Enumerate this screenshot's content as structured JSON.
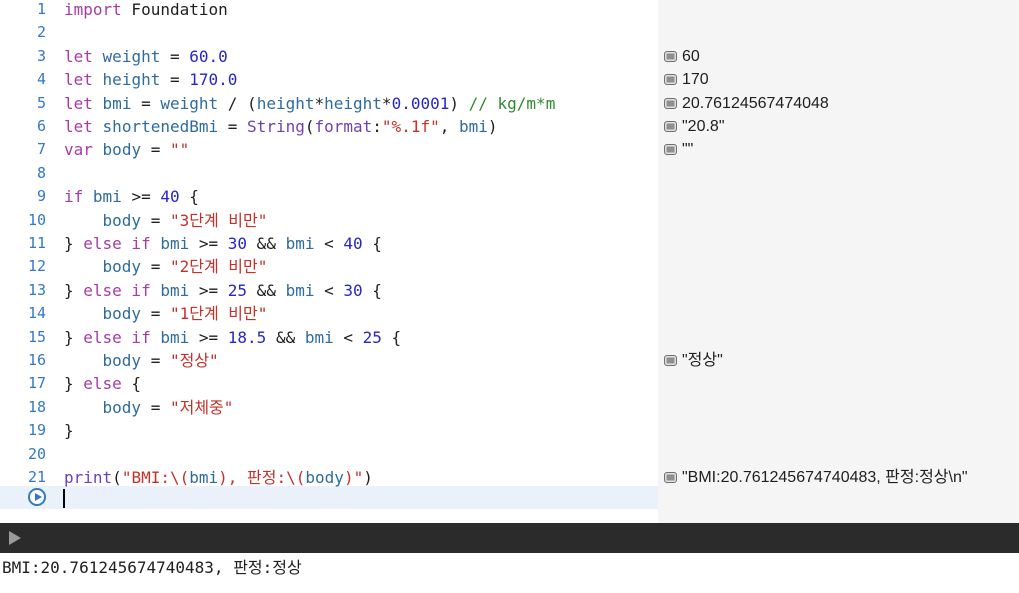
{
  "editor": {
    "lines": [
      {
        "num": "1",
        "tokens": [
          {
            "t": "import",
            "c": "kw"
          },
          {
            "t": " Foundation",
            "c": "p"
          }
        ]
      },
      {
        "num": "2",
        "tokens": []
      },
      {
        "num": "3",
        "tokens": [
          {
            "t": "let",
            "c": "kw"
          },
          {
            "t": " ",
            "c": "p"
          },
          {
            "t": "weight",
            "c": "v"
          },
          {
            "t": " = ",
            "c": "p"
          },
          {
            "t": "60.0",
            "c": "n"
          }
        ]
      },
      {
        "num": "4",
        "tokens": [
          {
            "t": "let",
            "c": "kw"
          },
          {
            "t": " ",
            "c": "p"
          },
          {
            "t": "height",
            "c": "v"
          },
          {
            "t": " = ",
            "c": "p"
          },
          {
            "t": "170.0",
            "c": "n"
          }
        ]
      },
      {
        "num": "5",
        "tokens": [
          {
            "t": "let",
            "c": "kw"
          },
          {
            "t": " ",
            "c": "p"
          },
          {
            "t": "bmi",
            "c": "v"
          },
          {
            "t": " = ",
            "c": "p"
          },
          {
            "t": "weight",
            "c": "v"
          },
          {
            "t": " / (",
            "c": "p"
          },
          {
            "t": "height",
            "c": "v"
          },
          {
            "t": "*",
            "c": "p"
          },
          {
            "t": "height",
            "c": "v"
          },
          {
            "t": "*",
            "c": "p"
          },
          {
            "t": "0.0001",
            "c": "n"
          },
          {
            "t": ") ",
            "c": "p"
          },
          {
            "t": "// kg/m*m",
            "c": "c"
          }
        ]
      },
      {
        "num": "6",
        "tokens": [
          {
            "t": "let",
            "c": "kw"
          },
          {
            "t": " ",
            "c": "p"
          },
          {
            "t": "shortenedBmi",
            "c": "v"
          },
          {
            "t": " = ",
            "c": "p"
          },
          {
            "t": "String",
            "c": "t"
          },
          {
            "t": "(",
            "c": "p"
          },
          {
            "t": "format",
            "c": "t"
          },
          {
            "t": ":",
            "c": "p"
          },
          {
            "t": "\"%.1f\"",
            "c": "s"
          },
          {
            "t": ", ",
            "c": "p"
          },
          {
            "t": "bmi",
            "c": "v"
          },
          {
            "t": ")",
            "c": "p"
          }
        ]
      },
      {
        "num": "7",
        "tokens": [
          {
            "t": "var",
            "c": "kw"
          },
          {
            "t": " ",
            "c": "p"
          },
          {
            "t": "body",
            "c": "v"
          },
          {
            "t": " = ",
            "c": "p"
          },
          {
            "t": "\"\"",
            "c": "s"
          }
        ]
      },
      {
        "num": "8",
        "tokens": []
      },
      {
        "num": "9",
        "tokens": [
          {
            "t": "if",
            "c": "kw"
          },
          {
            "t": " ",
            "c": "p"
          },
          {
            "t": "bmi",
            "c": "v"
          },
          {
            "t": " >= ",
            "c": "p"
          },
          {
            "t": "40",
            "c": "n"
          },
          {
            "t": " {",
            "c": "p"
          }
        ]
      },
      {
        "num": "10",
        "tokens": [
          {
            "t": "    ",
            "c": "p"
          },
          {
            "t": "body",
            "c": "v"
          },
          {
            "t": " = ",
            "c": "p"
          },
          {
            "t": "\"3단계 비만\"",
            "c": "s"
          }
        ]
      },
      {
        "num": "11",
        "tokens": [
          {
            "t": "} ",
            "c": "p"
          },
          {
            "t": "else if",
            "c": "kw"
          },
          {
            "t": " ",
            "c": "p"
          },
          {
            "t": "bmi",
            "c": "v"
          },
          {
            "t": " >= ",
            "c": "p"
          },
          {
            "t": "30",
            "c": "n"
          },
          {
            "t": " && ",
            "c": "p"
          },
          {
            "t": "bmi",
            "c": "v"
          },
          {
            "t": " < ",
            "c": "p"
          },
          {
            "t": "40",
            "c": "n"
          },
          {
            "t": " {",
            "c": "p"
          }
        ]
      },
      {
        "num": "12",
        "tokens": [
          {
            "t": "    ",
            "c": "p"
          },
          {
            "t": "body",
            "c": "v"
          },
          {
            "t": " = ",
            "c": "p"
          },
          {
            "t": "\"2단계 비만\"",
            "c": "s"
          }
        ]
      },
      {
        "num": "13",
        "tokens": [
          {
            "t": "} ",
            "c": "p"
          },
          {
            "t": "else if",
            "c": "kw"
          },
          {
            "t": " ",
            "c": "p"
          },
          {
            "t": "bmi",
            "c": "v"
          },
          {
            "t": " >= ",
            "c": "p"
          },
          {
            "t": "25",
            "c": "n"
          },
          {
            "t": " && ",
            "c": "p"
          },
          {
            "t": "bmi",
            "c": "v"
          },
          {
            "t": " < ",
            "c": "p"
          },
          {
            "t": "30",
            "c": "n"
          },
          {
            "t": " {",
            "c": "p"
          }
        ]
      },
      {
        "num": "14",
        "tokens": [
          {
            "t": "    ",
            "c": "p"
          },
          {
            "t": "body",
            "c": "v"
          },
          {
            "t": " = ",
            "c": "p"
          },
          {
            "t": "\"1단계 비만\"",
            "c": "s"
          }
        ]
      },
      {
        "num": "15",
        "tokens": [
          {
            "t": "} ",
            "c": "p"
          },
          {
            "t": "else if",
            "c": "kw"
          },
          {
            "t": " ",
            "c": "p"
          },
          {
            "t": "bmi",
            "c": "v"
          },
          {
            "t": " >= ",
            "c": "p"
          },
          {
            "t": "18.5",
            "c": "n"
          },
          {
            "t": " && ",
            "c": "p"
          },
          {
            "t": "bmi",
            "c": "v"
          },
          {
            "t": " < ",
            "c": "p"
          },
          {
            "t": "25",
            "c": "n"
          },
          {
            "t": " {",
            "c": "p"
          }
        ]
      },
      {
        "num": "16",
        "tokens": [
          {
            "t": "    ",
            "c": "p"
          },
          {
            "t": "body",
            "c": "v"
          },
          {
            "t": " = ",
            "c": "p"
          },
          {
            "t": "\"정상\"",
            "c": "s"
          }
        ]
      },
      {
        "num": "17",
        "tokens": [
          {
            "t": "} ",
            "c": "p"
          },
          {
            "t": "else",
            "c": "kw"
          },
          {
            "t": " {",
            "c": "p"
          }
        ]
      },
      {
        "num": "18",
        "tokens": [
          {
            "t": "    ",
            "c": "p"
          },
          {
            "t": "body",
            "c": "v"
          },
          {
            "t": " = ",
            "c": "p"
          },
          {
            "t": "\"저체중\"",
            "c": "s"
          }
        ]
      },
      {
        "num": "19",
        "tokens": [
          {
            "t": "}",
            "c": "p"
          }
        ]
      },
      {
        "num": "20",
        "tokens": []
      },
      {
        "num": "21",
        "tokens": [
          {
            "t": "print",
            "c": "t"
          },
          {
            "t": "(",
            "c": "p"
          },
          {
            "t": "\"BMI:\\(",
            "c": "s"
          },
          {
            "t": "bmi",
            "c": "v"
          },
          {
            "t": "), 판정:\\(",
            "c": "s"
          },
          {
            "t": "body",
            "c": "v"
          },
          {
            "t": ")\"",
            "c": "s"
          },
          {
            "t": ")",
            "c": "p"
          }
        ]
      }
    ]
  },
  "results": [
    {
      "line": 3,
      "text": "60"
    },
    {
      "line": 4,
      "text": "170"
    },
    {
      "line": 5,
      "text": "20.76124567474048"
    },
    {
      "line": 6,
      "text": "\"20.8\""
    },
    {
      "line": 7,
      "text": "\"\""
    },
    {
      "line": 16,
      "text": "\"정상\""
    },
    {
      "line": 21,
      "text": "\"BMI:20.761245674740483, 판정:정상\\n\""
    }
  ],
  "console": {
    "output": "BMI:20.761245674740483, 판정:정상"
  },
  "icons": {
    "run": "play-circle-icon",
    "debug_toggle": "play-icon",
    "result_marker": "quick-look-icon"
  },
  "colors": {
    "keyword": "#a93aa8",
    "variable": "#2e6b9e",
    "number": "#2626c8",
    "string": "#c4312b",
    "comment": "#2f8a2f",
    "type": "#6f3fb6",
    "line_number": "#3478c6",
    "debug_bar": "#2b2b2b"
  }
}
